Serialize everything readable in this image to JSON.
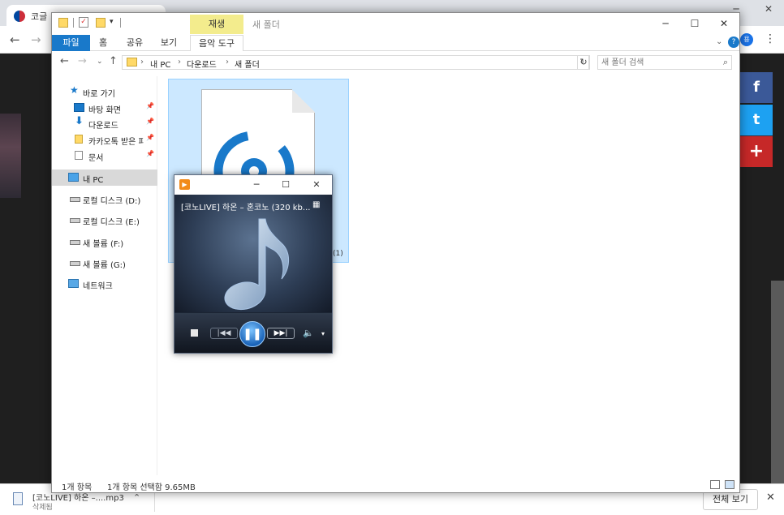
{
  "browser": {
    "tab_title": "코글 ",
    "download": {
      "filename": "[코노LIVE] 하온 –....mp3",
      "status": "삭제됨",
      "show_all": "전체 보기"
    },
    "share": {
      "facebook": "f",
      "twitter": "t",
      "plus": "+"
    },
    "avatar_letter": "용"
  },
  "explorer": {
    "context_tab_header": "재생",
    "window_title": "새 폴더",
    "ribbon_tabs": [
      "파일",
      "홈",
      "공유",
      "보기",
      "음악 도구"
    ],
    "breadcrumbs": [
      "내 PC",
      "다운로드",
      "새 폴더"
    ],
    "search_placeholder": "새 폴더 검색",
    "nav": {
      "quick_access": "바로 가기",
      "desktop": "바탕 화면",
      "downloads": "다운로드",
      "kakao": "카카오톡 받은 파",
      "documents": "문서",
      "this_pc": "내 PC",
      "drive_d": "로컬 디스크 (D:)",
      "drive_e": "로컬 디스크 (E:)",
      "drive_f": "새 볼륨 (F:)",
      "drive_g": "새 볼륨 (G:)",
      "network": "네트워크"
    },
    "file_label_suffix": "(1)",
    "status": {
      "item_count": "1개 항목",
      "selected": "1개 항목 선택함 9.65MB"
    }
  },
  "player": {
    "track_title": "[코노LIVE] 하온 – 혼코노 (320  kb...",
    "progress": 0.04
  },
  "colors": {
    "accent": "#1979ca",
    "selection": "#cce8ff",
    "context_tab": "#f3ec8d"
  }
}
